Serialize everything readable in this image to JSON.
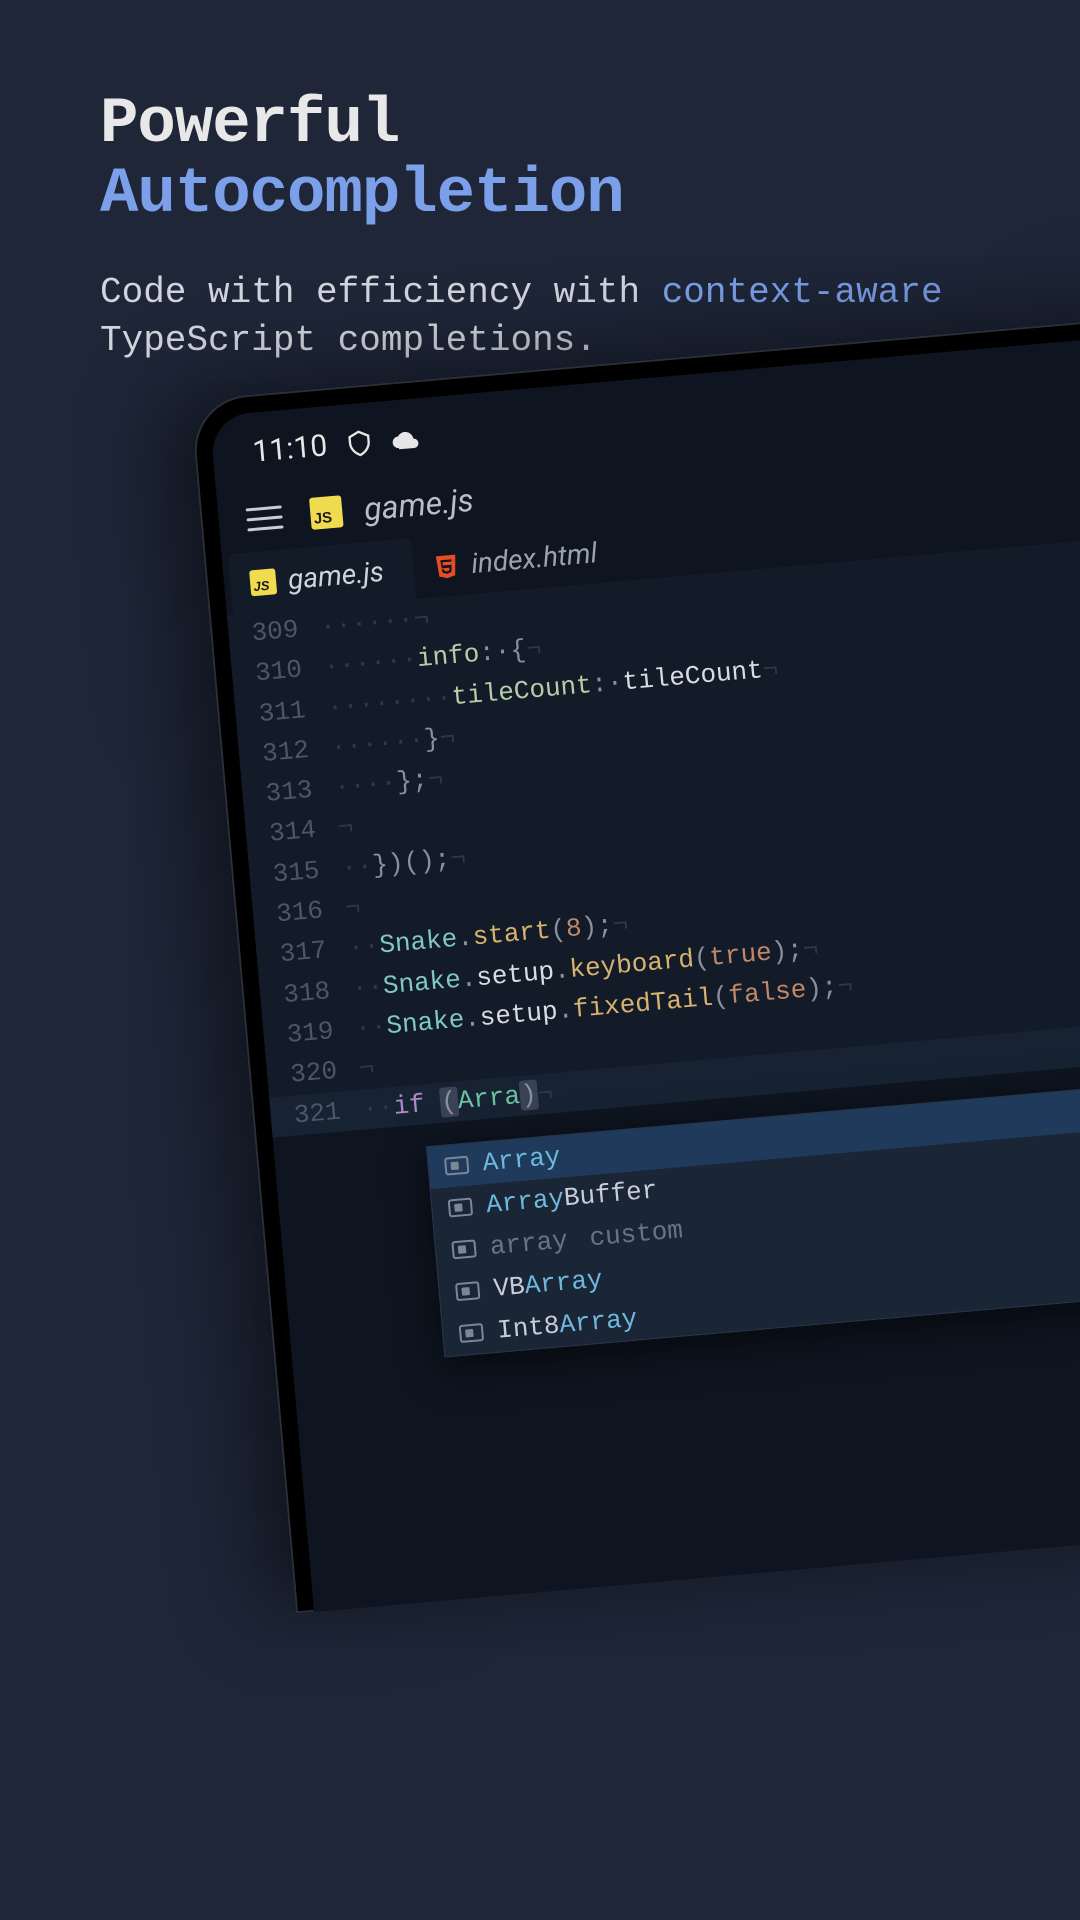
{
  "hero": {
    "title_line1": "Powerful",
    "title_line2": "Autocompletion",
    "sub_1": "Code with efficiency with",
    "sub_accent": "context-aware",
    "sub_2": " TypeScript completions."
  },
  "status": {
    "time": "11:10"
  },
  "appbar": {
    "filename": "game.js",
    "js_badge": "JS"
  },
  "tabs": [
    {
      "label": "game.js",
      "badge": "JS",
      "active": true
    },
    {
      "label": "index.html",
      "badge": "HTML",
      "active": false
    }
  ],
  "lines": [
    {
      "n": "309",
      "ws": "······",
      "code": "¬"
    },
    {
      "n": "310",
      "ws": "······",
      "tokens": [
        [
          "prop",
          "info"
        ],
        [
          "punc",
          ":·"
        ],
        [
          "punc",
          "{"
        ],
        [
          "ws",
          "¬"
        ]
      ]
    },
    {
      "n": "311",
      "ws": "········",
      "tokens": [
        [
          "prop",
          "tileCount"
        ],
        [
          "punc",
          ":·"
        ],
        [
          "ident",
          "tileCount"
        ],
        [
          "ws",
          "¬"
        ]
      ]
    },
    {
      "n": "312",
      "ws": "······",
      "tokens": [
        [
          "punc",
          "}"
        ],
        [
          "ws",
          "¬"
        ]
      ]
    },
    {
      "n": "313",
      "ws": "····",
      "tokens": [
        [
          "punc",
          "};"
        ],
        [
          "ws",
          "¬"
        ]
      ]
    },
    {
      "n": "314",
      "ws": "",
      "code": "¬"
    },
    {
      "n": "315",
      "ws": "··",
      "tokens": [
        [
          "punc",
          "})();"
        ],
        [
          "ws",
          "¬"
        ]
      ]
    },
    {
      "n": "316",
      "ws": "",
      "code": "¬"
    },
    {
      "n": "317",
      "ws": "··",
      "tokens": [
        [
          "obj",
          "Snake"
        ],
        [
          "punc",
          "."
        ],
        [
          "method",
          "start"
        ],
        [
          "punc",
          "("
        ],
        [
          "num",
          "8"
        ],
        [
          "punc",
          ");"
        ],
        [
          "ws",
          "¬"
        ]
      ]
    },
    {
      "n": "318",
      "ws": "··",
      "tokens": [
        [
          "obj",
          "Snake"
        ],
        [
          "punc",
          "."
        ],
        [
          "ident",
          "setup"
        ],
        [
          "punc",
          "."
        ],
        [
          "method",
          "keyboard"
        ],
        [
          "punc",
          "("
        ],
        [
          "bool",
          "true"
        ],
        [
          "punc",
          ");"
        ],
        [
          "ws",
          "¬"
        ]
      ]
    },
    {
      "n": "319",
      "ws": "··",
      "tokens": [
        [
          "obj",
          "Snake"
        ],
        [
          "punc",
          "."
        ],
        [
          "ident",
          "setup"
        ],
        [
          "punc",
          "."
        ],
        [
          "method",
          "fixedTail"
        ],
        [
          "punc",
          "("
        ],
        [
          "bool",
          "false"
        ],
        [
          "punc",
          ");"
        ],
        [
          "ws",
          "¬"
        ]
      ]
    },
    {
      "n": "320",
      "ws": "",
      "code": "¬"
    },
    {
      "n": "321",
      "ws": "··",
      "error": true,
      "tokens": [
        [
          "kw",
          "if"
        ],
        [
          "ident",
          " "
        ],
        [
          "paren",
          "("
        ],
        [
          "partial",
          "Arra"
        ],
        [
          "paren",
          ")"
        ],
        [
          "ws",
          "¬"
        ]
      ]
    }
  ],
  "completion": [
    {
      "match": "Array",
      "rest": ""
    },
    {
      "match": "Array",
      "rest": "Buffer"
    },
    {
      "muted": "array",
      "detail": "custom"
    },
    {
      "pre": "VB",
      "match": "Array",
      "rest": ""
    },
    {
      "pre": "Int8",
      "match": "Array",
      "rest": ""
    }
  ],
  "run_glyph": "‹›"
}
